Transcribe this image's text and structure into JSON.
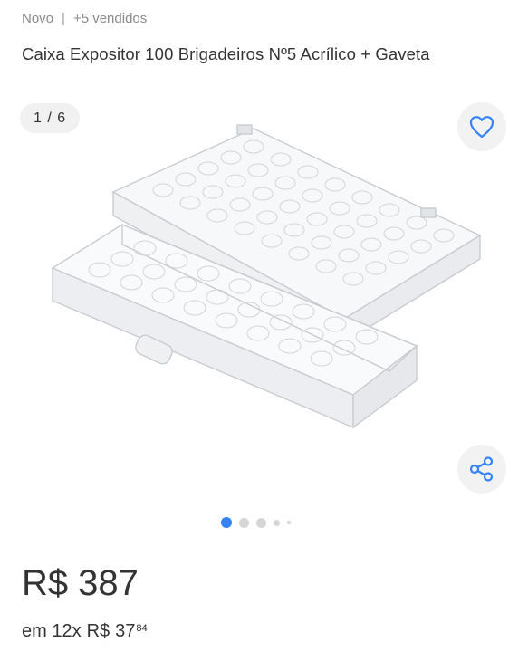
{
  "meta": {
    "condition": "Novo",
    "separator": "|",
    "sold": "+5 vendidos"
  },
  "title": "Caixa Expositor 100 Brigadeiros Nº5 Acrílico + Gaveta",
  "gallery": {
    "counter": "1 / 6",
    "image_count": 6,
    "current_index": 1,
    "favorite_icon": "heart-icon",
    "share_icon": "share-icon",
    "accent": "#3483fa"
  },
  "price": {
    "currency": "R$",
    "amount": "387"
  },
  "installments": {
    "prefix": "em 12x",
    "currency": "R$",
    "amount": "37",
    "cents": "84"
  }
}
